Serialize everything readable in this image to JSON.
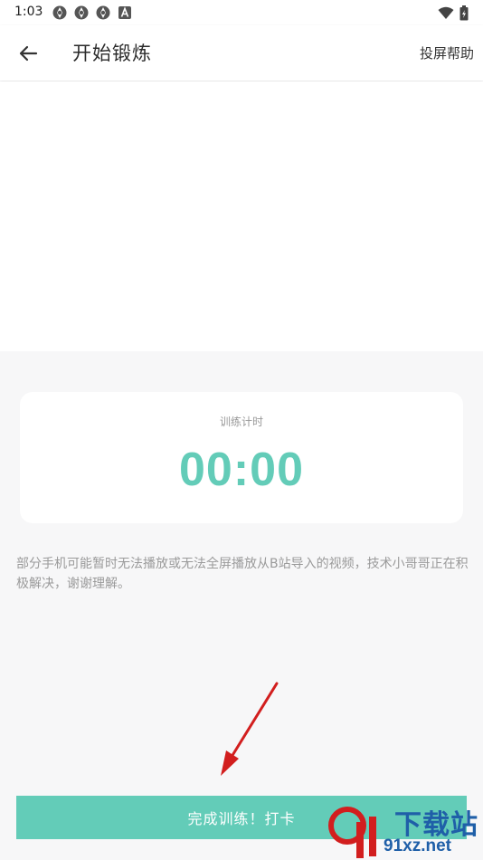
{
  "status_bar": {
    "time": "1:03",
    "notification_icons": [
      "aperture-icon",
      "aperture-icon",
      "aperture-icon",
      "a-icon"
    ],
    "right_icons": [
      "wifi-icon",
      "battery-icon"
    ]
  },
  "app_bar": {
    "back_icon": "arrow-left-icon",
    "title": "开始锻炼",
    "action_label": "投屏帮助"
  },
  "timer_card": {
    "label": "训练计时",
    "value": "00:00"
  },
  "notice": {
    "text": "部分手机可能暂时无法播放或无法全屏播放从B站导入的视频，技术小哥哥正在积极解决，谢谢理解。"
  },
  "finish_button": {
    "label": "完成训练！打卡"
  },
  "watermark": {
    "top_text": "下载站",
    "bottom_text": "91xz.net"
  },
  "colors": {
    "accent": "#63ccb8",
    "annotation_arrow": "#d21e1e",
    "watermark": "#1f5fa8"
  }
}
